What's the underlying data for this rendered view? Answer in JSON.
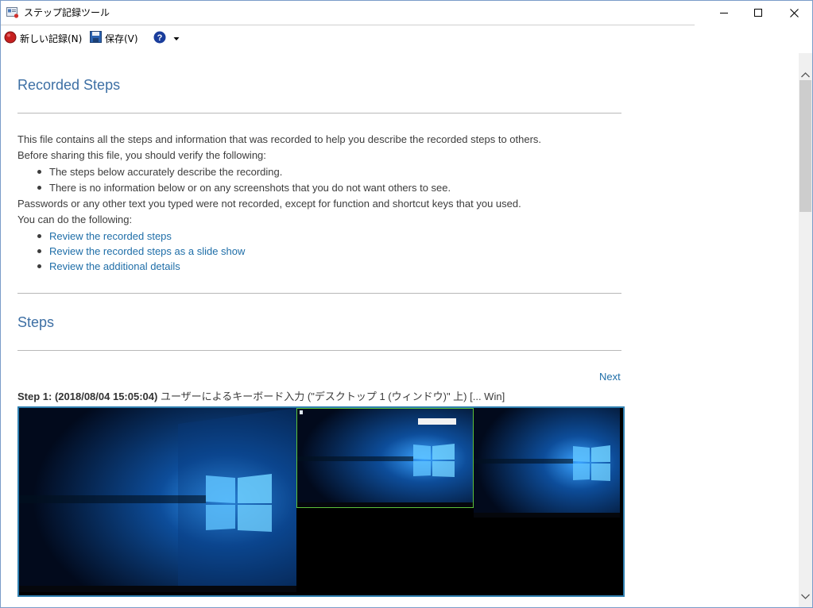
{
  "window": {
    "title": "ステップ記録ツール"
  },
  "toolbar": {
    "new_record_label": "新しい記録(N)",
    "save_label": "保存(V)"
  },
  "report": {
    "heading": "Recorded Steps",
    "intro_1": "This file contains all the steps and information that was recorded to help you describe the recorded steps to others.",
    "intro_2": "Before sharing this file, you should verify the following:",
    "verify_items": [
      "The steps below accurately describe the recording.",
      "There is no information below or on any screenshots that you do not want others to see."
    ],
    "intro_3": "Passwords or any other text you typed were not recorded, except for function and shortcut keys that you used.",
    "intro_4": "You can do the following:",
    "links": [
      "Review the recorded steps",
      "Review the recorded steps as a slide show",
      "Review the additional details"
    ],
    "steps_heading": "Steps",
    "next_label": "Next",
    "step1_prefix": "Step 1: (2018/08/04 15:05:04)",
    "step1_text": " ユーザーによるキーボード入力 (\"デスクトップ 1 (ウィンドウ)\" 上) [... Win]"
  },
  "colors": {
    "heading": "#3d6fa4",
    "link": "#1f6ea8",
    "text": "#3c3c3c"
  }
}
